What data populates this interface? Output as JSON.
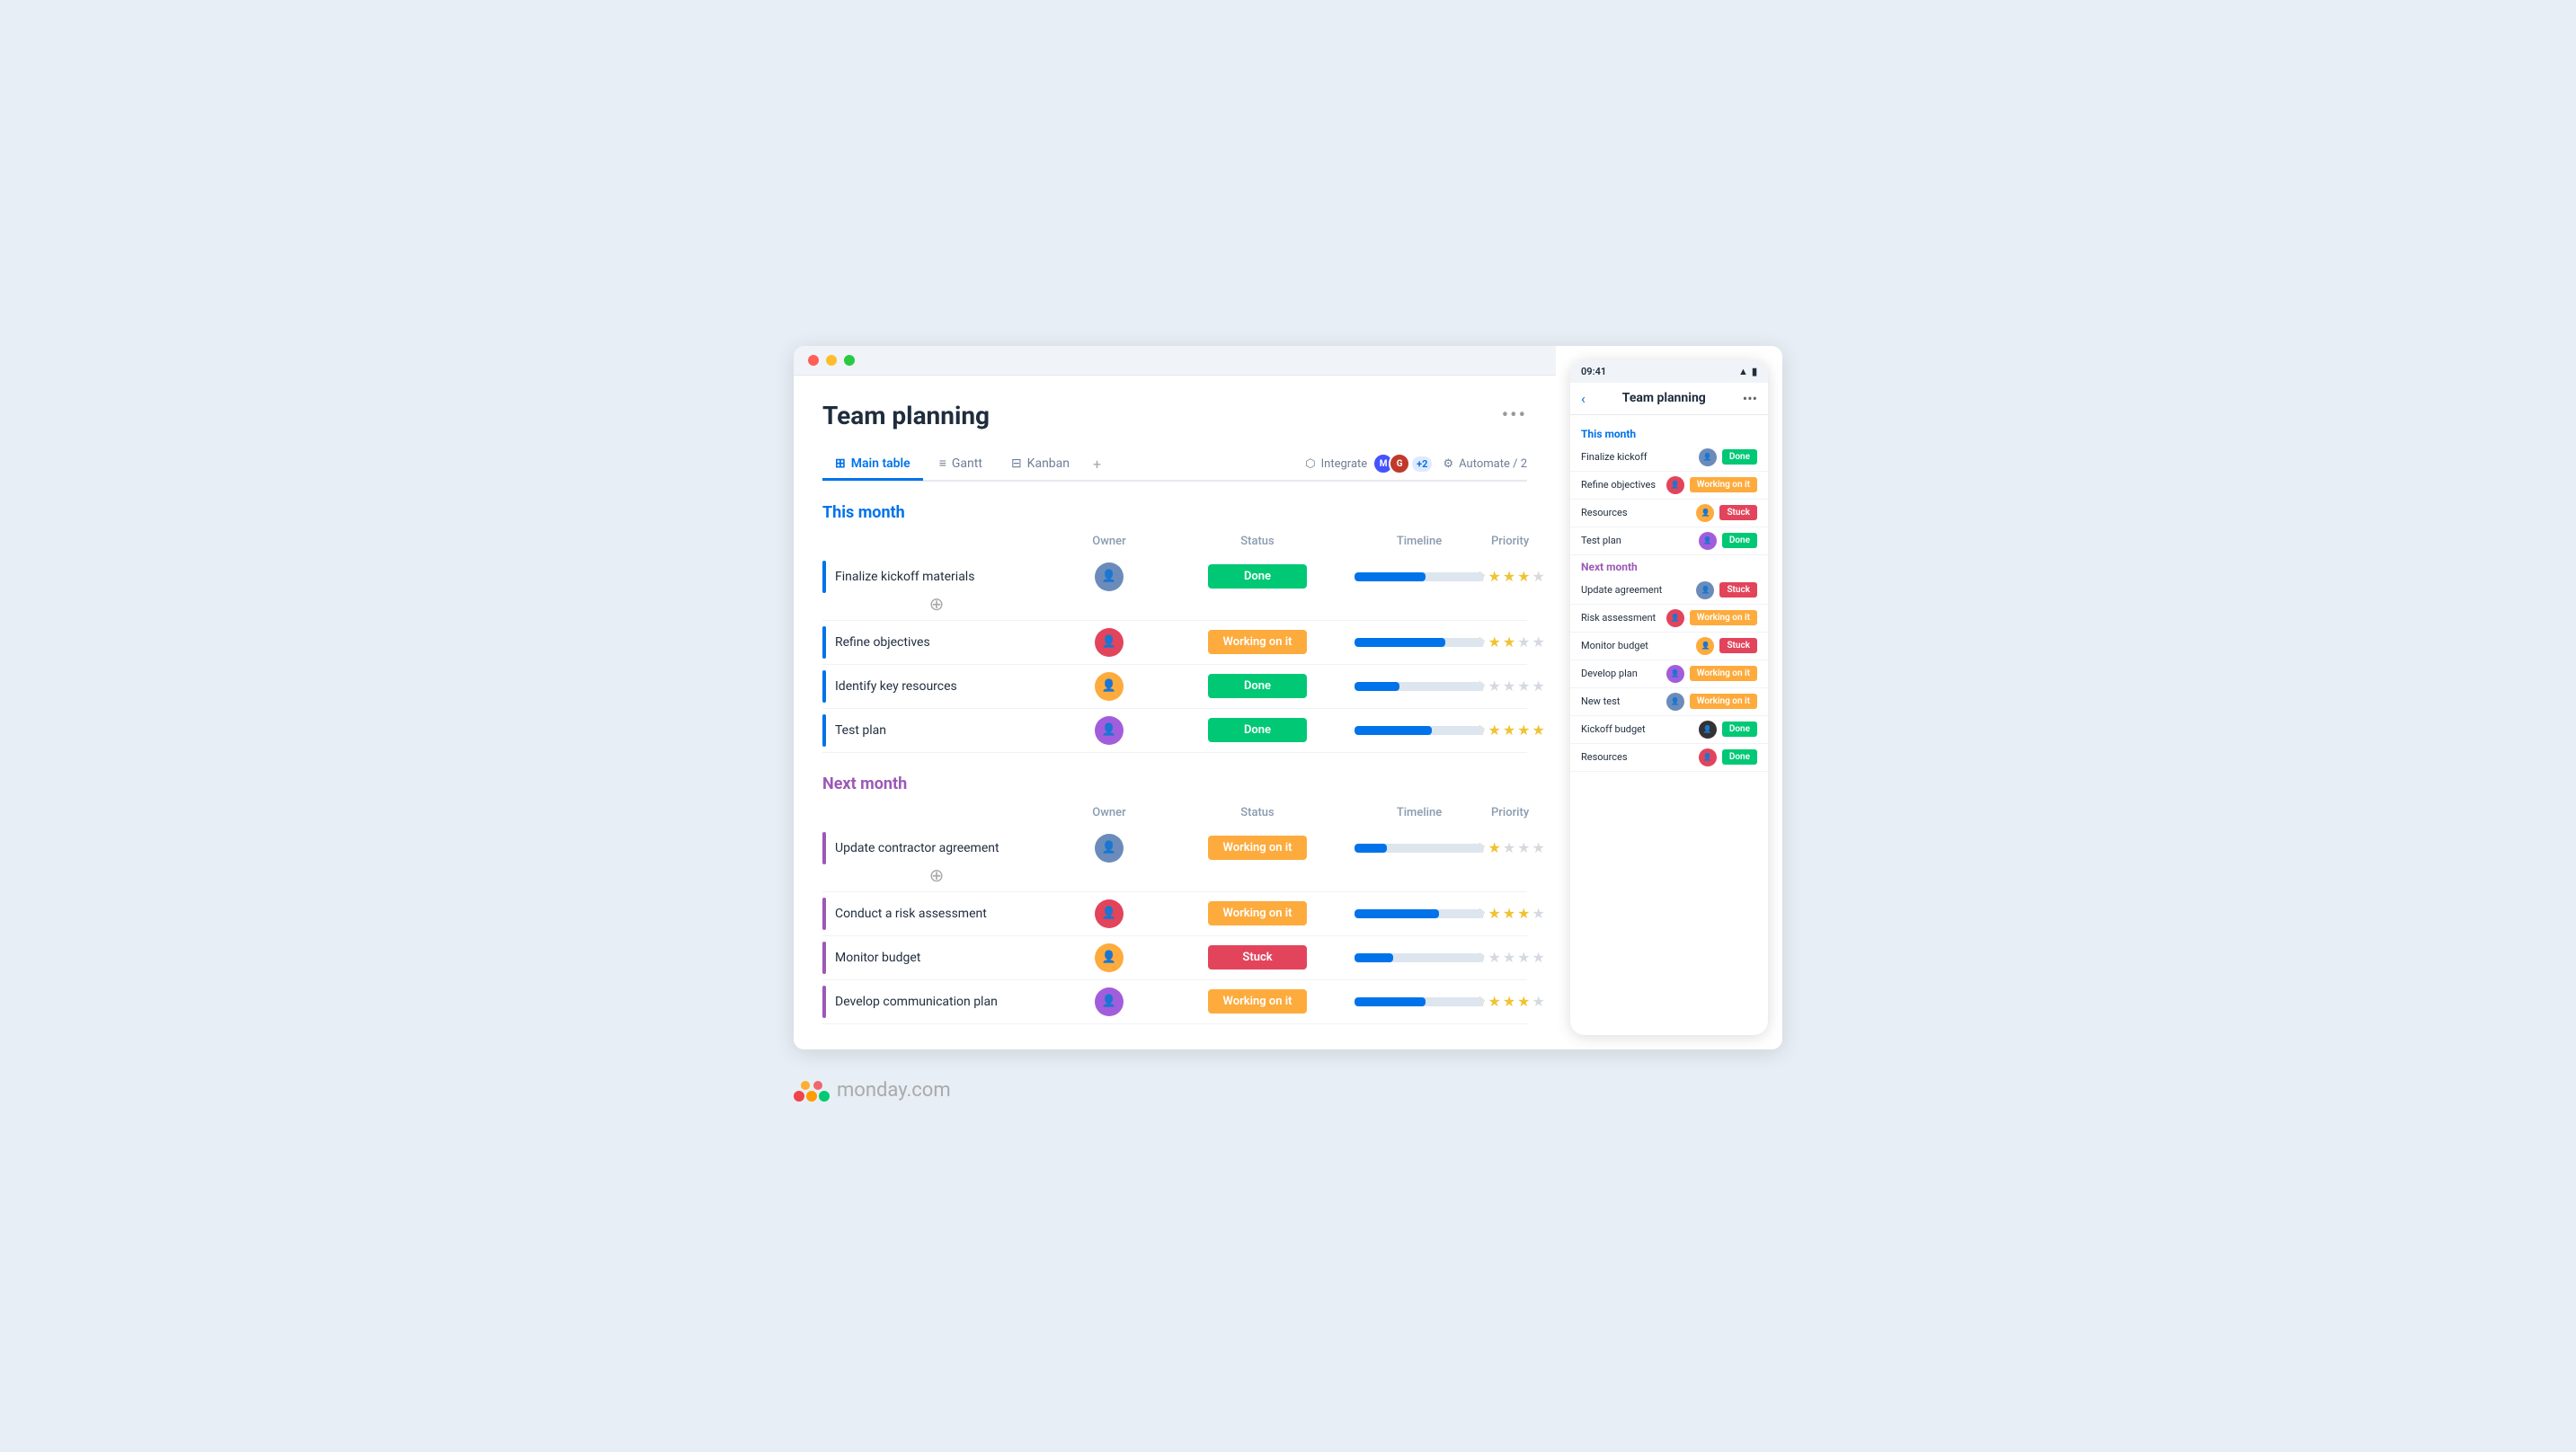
{
  "browser": {
    "dots": [
      "red",
      "yellow",
      "green"
    ]
  },
  "page": {
    "title": "Team planning",
    "more_label": "•••"
  },
  "tabs": {
    "items": [
      {
        "id": "main-table",
        "label": "Main table",
        "icon": "⊞",
        "active": true
      },
      {
        "id": "gantt",
        "label": "Gantt",
        "icon": "≡",
        "active": false
      },
      {
        "id": "kanban",
        "label": "Kanban",
        "icon": "⊟",
        "active": false
      }
    ],
    "plus_label": "+",
    "integrate_label": "Integrate",
    "automate_label": "Automate / 2",
    "plus_badge": "+2"
  },
  "this_month": {
    "section_title": "This month",
    "columns": {
      "owner": "Owner",
      "status": "Status",
      "timeline": "Timeline",
      "priority": "Priority"
    },
    "rows": [
      {
        "name": "Finalize kickoff materials",
        "owner_color": "#6b8cba",
        "status": "Done",
        "status_class": "done",
        "timeline_fill": 55,
        "stars": [
          1,
          1,
          1,
          1,
          0
        ]
      },
      {
        "name": "Refine objectives",
        "owner_color": "#e2445c",
        "status": "Working on it",
        "status_class": "working",
        "timeline_fill": 70,
        "stars": [
          1,
          1,
          1,
          0,
          0
        ]
      },
      {
        "name": "Identify key resources",
        "owner_color": "#fdab3d",
        "status": "Done",
        "status_class": "done",
        "timeline_fill": 35,
        "stars": [
          1,
          0,
          0,
          0,
          0
        ]
      },
      {
        "name": "Test plan",
        "owner_color": "#a25ddc",
        "status": "Done",
        "status_class": "done",
        "timeline_fill": 60,
        "stars": [
          1,
          1,
          1,
          1,
          1
        ]
      }
    ]
  },
  "next_month": {
    "section_title": "Next month",
    "columns": {
      "owner": "Owner",
      "status": "Status",
      "timeline": "Timeline",
      "priority": "Priority"
    },
    "rows": [
      {
        "name": "Update contractor agreement",
        "owner_color": "#6b8cba",
        "status": "Working on it",
        "status_class": "working",
        "timeline_fill": 25,
        "stars": [
          1,
          1,
          0,
          0,
          0
        ]
      },
      {
        "name": "Conduct a risk assessment",
        "owner_color": "#e2445c",
        "status": "Working on it",
        "status_class": "working",
        "timeline_fill": 65,
        "stars": [
          1,
          1,
          1,
          1,
          0
        ]
      },
      {
        "name": "Monitor budget",
        "owner_color": "#fdab3d",
        "status": "Stuck",
        "status_class": "stuck",
        "timeline_fill": 30,
        "stars": [
          0,
          0,
          0,
          0,
          0
        ]
      },
      {
        "name": "Develop communication plan",
        "owner_color": "#a25ddc",
        "status": "Working on it",
        "status_class": "working",
        "timeline_fill": 55,
        "stars": [
          1,
          1,
          1,
          1,
          0
        ]
      }
    ]
  },
  "mobile": {
    "time": "09:41",
    "header_title": "Team planning",
    "this_month_label": "This month",
    "next_month_label": "Next month",
    "this_month_rows": [
      {
        "name": "Finalize kickoff",
        "owner_color": "#6b8cba",
        "status": "Done",
        "status_class": "done"
      },
      {
        "name": "Refine objectives",
        "owner_color": "#e2445c",
        "status": "Working on it",
        "status_class": "working"
      },
      {
        "name": "Resources",
        "owner_color": "#fdab3d",
        "status": "Stuck",
        "status_class": "stuck"
      },
      {
        "name": "Test plan",
        "owner_color": "#a25ddc",
        "status": "Done",
        "status_class": "done"
      }
    ],
    "next_month_rows": [
      {
        "name": "Update agreement",
        "owner_color": "#6b8cba",
        "status": "Stuck",
        "status_class": "stuck"
      },
      {
        "name": "Risk assessment",
        "owner_color": "#e2445c",
        "status": "Working on it",
        "status_class": "working"
      },
      {
        "name": "Monitor budget",
        "owner_color": "#fdab3d",
        "status": "Stuck",
        "status_class": "stuck"
      },
      {
        "name": "Develop plan",
        "owner_color": "#a25ddc",
        "status": "Working on it",
        "status_class": "working"
      },
      {
        "name": "New test",
        "owner_color": "#6b8cba",
        "status": "Working on it",
        "status_class": "working"
      },
      {
        "name": "Kickoff budget",
        "owner_color": "#333",
        "status": "Done",
        "status_class": "done"
      },
      {
        "name": "Resources",
        "owner_color": "#e2445c",
        "status": "Done",
        "status_class": "done"
      }
    ]
  },
  "logo": {
    "text_bold": "monday",
    "text_light": ".com"
  }
}
